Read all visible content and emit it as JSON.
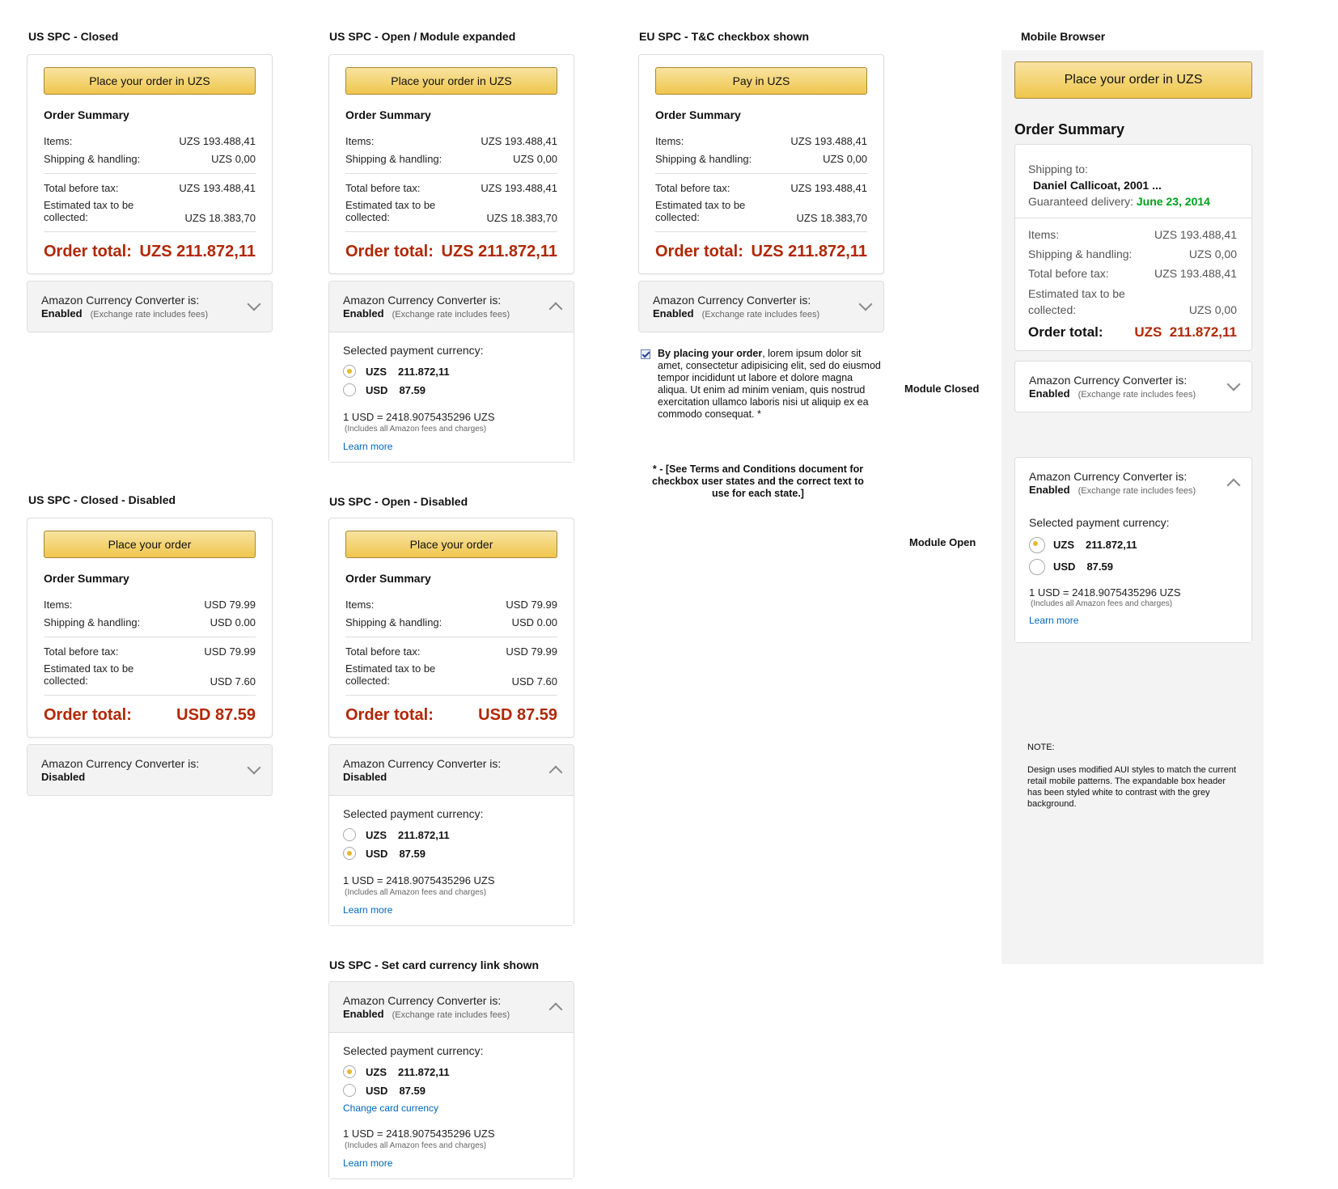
{
  "sections": {
    "us_closed": "US SPC  -  Closed",
    "us_open": "US SPC  -  Open / Module expanded",
    "eu_tc": "EU SPC  -  T&C checkbox shown",
    "mobile": "Mobile Browser",
    "us_closed_disabled": "US SPC  -  Closed  -  Disabled",
    "us_open_disabled": "US SPC  -  Open  -  Disabled",
    "us_card_currency": "US SPC  -  Set card currency link shown"
  },
  "summary": {
    "title": "Order Summary",
    "items_label": "Items:",
    "shipping_label": "Shipping & handling:",
    "before_tax_label": "Total before tax:",
    "tax_label_1": "Estimated tax to be",
    "tax_label_2": "collected:",
    "total_label": "Order total:"
  },
  "uzs": {
    "items": "UZS 193.488,41",
    "shipping": "UZS 0,00",
    "before_tax": "UZS 193.488,41",
    "tax": "UZS 18.383,70",
    "total": "UZS 211.872,11"
  },
  "usd": {
    "items": "USD 79.99",
    "shipping": "USD 0.00",
    "before_tax": "USD 79.99",
    "tax": "USD 7.60",
    "total": "USD 87.59"
  },
  "buttons": {
    "place_uzs": "Place your order in UZS",
    "pay_uzs": "Pay in UZS",
    "place": "Place your order"
  },
  "converter": {
    "label": "Amazon Currency Converter is:",
    "enabled": "Enabled",
    "disabled": "Disabled",
    "fees_note": "(Exchange rate includes fees)",
    "selected_label": "Selected payment currency:",
    "opt_uzs_code": "UZS",
    "opt_uzs_amount": "211.872,11",
    "opt_usd_code": "USD",
    "opt_usd_amount": "87.59",
    "rate": "1 USD = 2418.9075435296 UZS",
    "rate_note": "(Includes all Amazon fees and charges)",
    "learn_more": "Learn more",
    "change_card": "Change card currency"
  },
  "tc": {
    "bold": "By placing your order",
    "text": ", lorem ipsum dolor sit amet, consectetur adipisicing elit, sed do eiusmod tempor incididunt ut labore et dolore magna aliqua. Ut enim ad minim veniam, quis nostrud exercitation ullamco laboris nisi ut aliquip ex ea commodo consequat. *",
    "footnote": "* - [See Terms and Conditions document for checkbox user states and the correct text to use for each state.]"
  },
  "mobile": {
    "shipping_to": "Shipping to:",
    "address": "Daniel Callicoat, 2001 ...",
    "delivery_label": "Guaranteed delivery:",
    "delivery_date": "June 23, 2014",
    "tax": "UZS 0,00",
    "total_code": "UZS",
    "total_amount": "211.872,11",
    "module_closed": "Module Closed",
    "module_open": "Module Open",
    "note_title": "NOTE:",
    "note_text": "Design uses modified AUI styles to match the current retail mobile patterns.  The expandable box header has been styled white to contrast with the grey background."
  },
  "colors": {
    "price_red": "#b12704",
    "link_blue": "#0066c0",
    "delivery_green": "#00a11d",
    "button_gold": "#efc64c"
  }
}
